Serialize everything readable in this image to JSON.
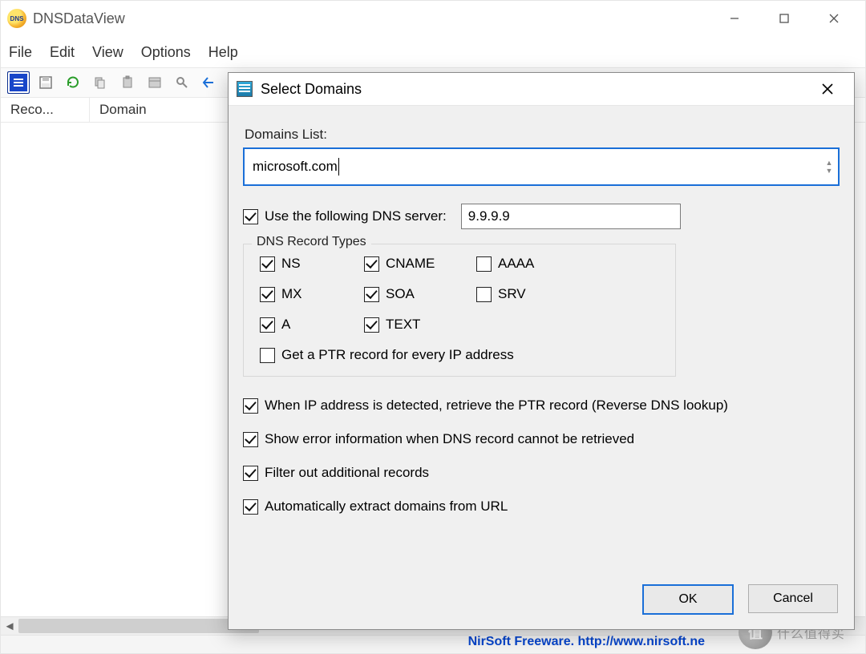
{
  "window": {
    "title": "DNSDataView"
  },
  "menu": {
    "file": "File",
    "edit": "Edit",
    "view": "View",
    "options": "Options",
    "help": "Help"
  },
  "columns": {
    "record": "Reco...",
    "domain": "Domain"
  },
  "dialog": {
    "title": "Select Domains",
    "domains_label": "Domains List:",
    "domains_value": "microsoft.com",
    "use_dns_label": "Use the following DNS server:",
    "use_dns_checked": true,
    "dns_server": "9.9.9.9",
    "record_types_legend": "DNS Record Types",
    "types": {
      "ns": {
        "label": "NS",
        "checked": true
      },
      "mx": {
        "label": "MX",
        "checked": true
      },
      "a": {
        "label": "A",
        "checked": true
      },
      "cname": {
        "label": "CNAME",
        "checked": true
      },
      "soa": {
        "label": "SOA",
        "checked": true
      },
      "text": {
        "label": "TEXT",
        "checked": true
      },
      "aaaa": {
        "label": "AAAA",
        "checked": false
      },
      "srv": {
        "label": "SRV",
        "checked": false
      }
    },
    "ptr_every_ip": {
      "label": "Get a  PTR record for every IP address",
      "checked": false
    },
    "opt_reverse": {
      "label": "When IP address is detected, retrieve the PTR record (Reverse DNS lookup)",
      "checked": true
    },
    "opt_errors": {
      "label": "Show error information when DNS record cannot be retrieved",
      "checked": true
    },
    "opt_filter": {
      "label": "Filter out additional records",
      "checked": true
    },
    "opt_extract": {
      "label": "Automatically extract domains from URL",
      "checked": true
    },
    "ok": "OK",
    "cancel": "Cancel"
  },
  "footer": {
    "link": "NirSoft Freeware.  http://www.nirsoft.ne"
  },
  "watermark": {
    "badge": "值",
    "text": "什么值得买"
  }
}
